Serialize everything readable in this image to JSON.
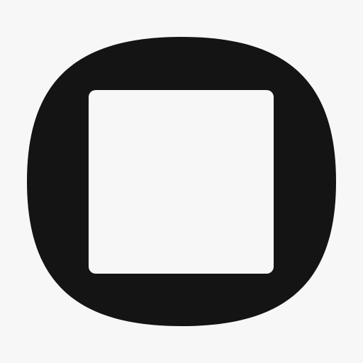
{
  "icon": {
    "name": "stop-icon",
    "background_color": "#f7f7f7",
    "outer_color": "#141414",
    "inner_color": "#f7f7f7"
  }
}
